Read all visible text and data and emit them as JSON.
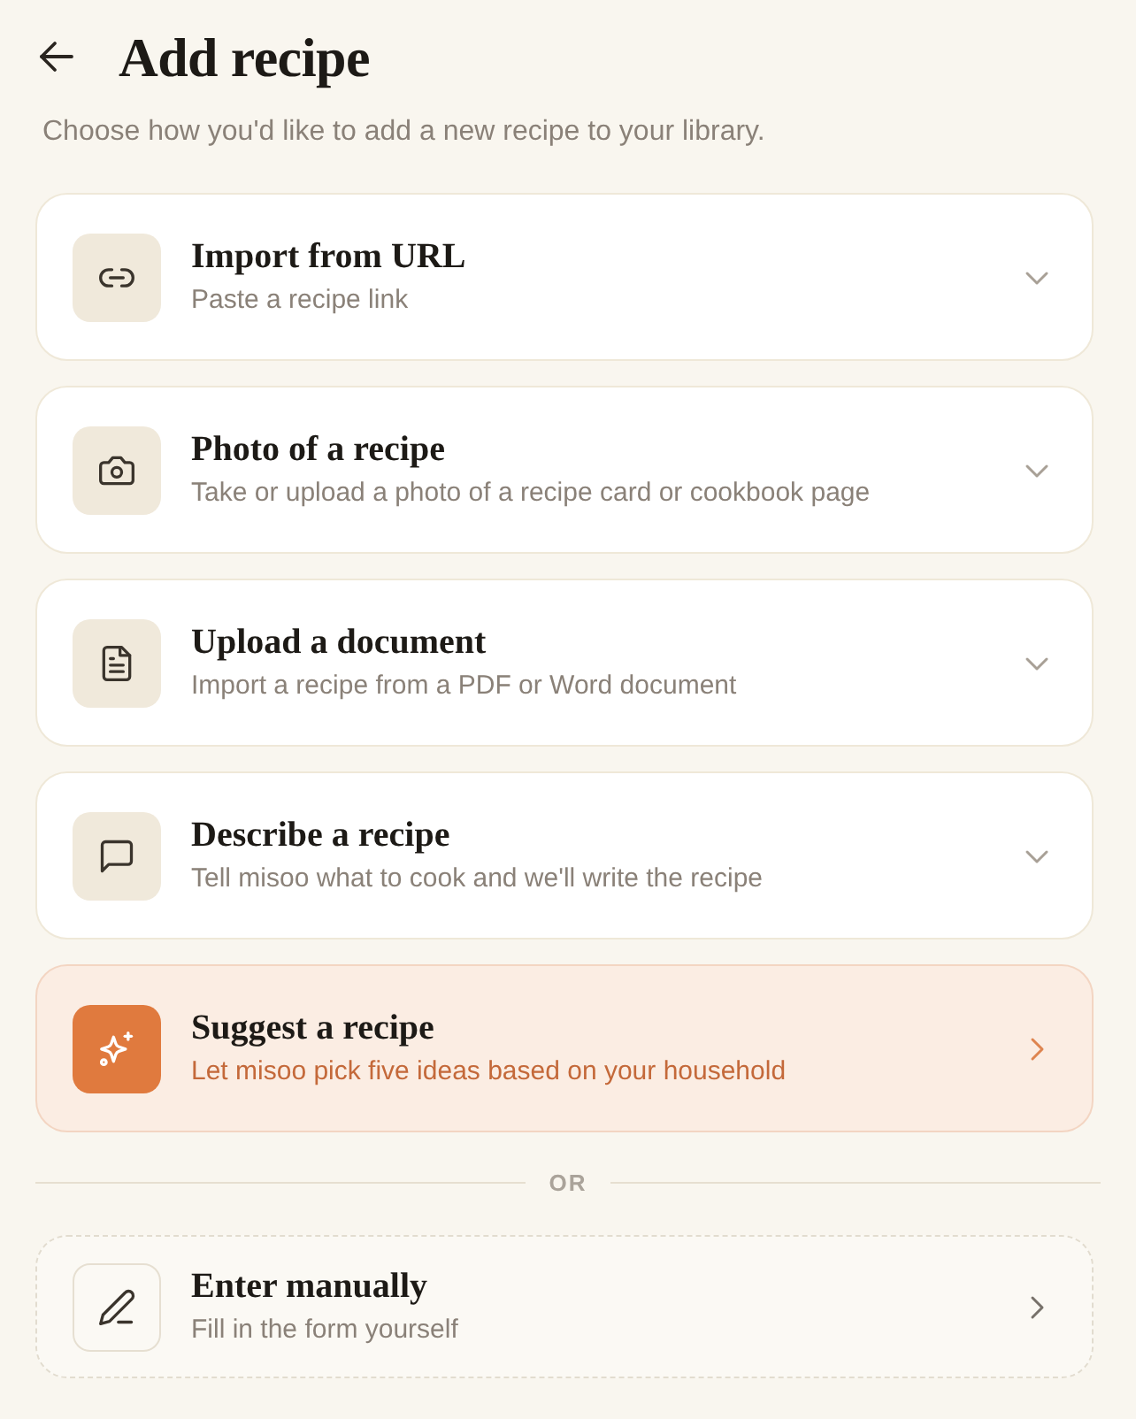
{
  "header": {
    "title": "Add recipe",
    "subtitle": "Choose how you'd like to add a new recipe to your library."
  },
  "options": [
    {
      "kind": "expand",
      "title": "Import from URL",
      "description": "Paste a recipe link"
    },
    {
      "kind": "expand",
      "title": "Photo of a recipe",
      "description": "Take or upload a photo of a recipe card or cookbook page"
    },
    {
      "kind": "expand",
      "title": "Upload a document",
      "description": "Import a recipe from a PDF or Word document"
    },
    {
      "kind": "expand",
      "title": "Describe a recipe",
      "description": "Tell misoo what to cook and we'll write the recipe"
    },
    {
      "kind": "featured",
      "title": "Suggest a recipe",
      "description": "Let misoo pick five ideas based on your household"
    }
  ],
  "divider": {
    "label": "OR"
  },
  "manual": {
    "kind": "plain",
    "title": "Enter manually",
    "description": "Fill in the form yourself"
  }
}
